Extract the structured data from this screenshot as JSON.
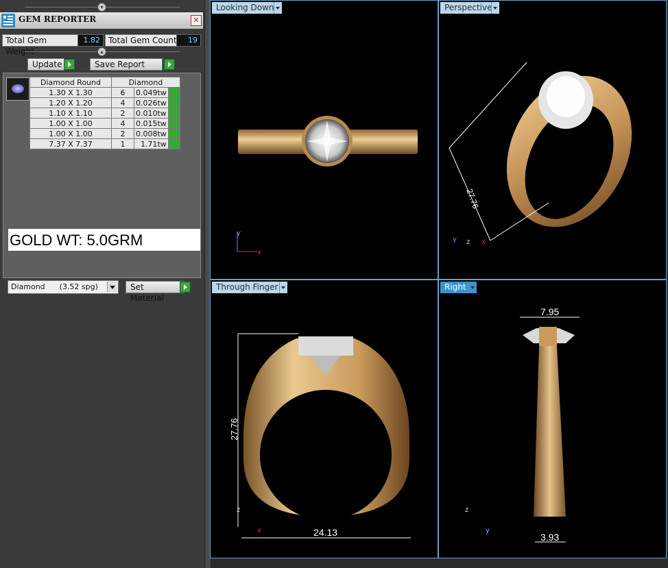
{
  "panel": {
    "title": "GEM REPORTER",
    "total_weight_label": "Total Gem Weight",
    "total_weight_value": "1.82",
    "total_count_label": "Total Gem Count",
    "total_count_value": "19",
    "update_label": "Update",
    "save_report_label": "Save Report",
    "table": {
      "headers": [
        "Diamond Round",
        "Diamond"
      ],
      "rows": [
        {
          "size": "1.30 X 1.30",
          "count": "6",
          "weight": "0.049tw"
        },
        {
          "size": "1.20 X 1.20",
          "count": "4",
          "weight": "0.026tw"
        },
        {
          "size": "1.10 X 1.10",
          "count": "2",
          "weight": "0.010tw"
        },
        {
          "size": "1.00 X 1.00",
          "count": "4",
          "weight": "0.015tw"
        },
        {
          "size": "1.00 X 1.00",
          "count": "2",
          "weight": "0.008tw"
        },
        {
          "size": "7.37 X 7.37",
          "count": "1",
          "weight": "1.71tw"
        }
      ]
    },
    "gold_weight_note": "GOLD WT: 5.0GRM",
    "material_select": "Diamond      (3.52 spg)",
    "set_material_label": "Set Material"
  },
  "viewports": {
    "top_left": {
      "label": "Looking Down",
      "axes": [
        "y",
        "x"
      ]
    },
    "top_right": {
      "label": "Perspective",
      "dim": "27.76",
      "axes": [
        "y",
        "z",
        "x"
      ]
    },
    "bottom_left": {
      "label": "Through Finger",
      "dim_height": "27.76",
      "dim_width": "24.13",
      "axes": [
        "z",
        "x"
      ]
    },
    "bottom_right": {
      "label": "Right",
      "dim_top": "7.95",
      "dim_bottom": "3.93",
      "axes": [
        "z",
        "y"
      ]
    }
  },
  "colors": {
    "gold": "#c9a064",
    "viewport_bg": "#000000",
    "tab_active": "#3b92d0",
    "value_text": "#7fd4ff"
  },
  "icons": [
    "gem-reporter-logo-icon",
    "close-icon",
    "play-arrow-icon",
    "chevron-down-icon",
    "collapse-arrow-icon"
  ]
}
